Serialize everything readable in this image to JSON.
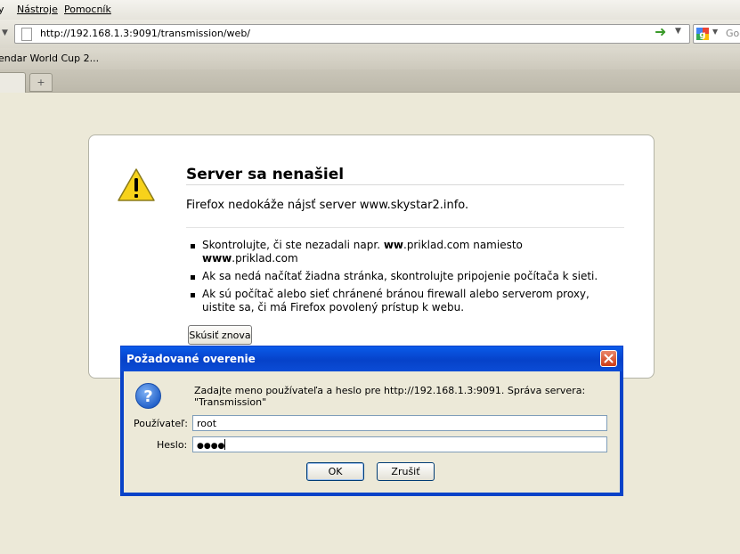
{
  "menu": {
    "items": [
      "y",
      "Nástroje",
      "Pomocník"
    ]
  },
  "navigation": {
    "url": "http://192.168.1.3:9091/transmission/web/",
    "search_placeholder": "Goo"
  },
  "bookmarks": {
    "items": [
      "endar World Cup 2..."
    ]
  },
  "tabs": {
    "new_tab_symbol": "+"
  },
  "error_page": {
    "title": "Server sa nenašiel",
    "short_desc": "Firefox nedokáže nájsť server www.skystar2.info.",
    "suggestion_1_pre": "Skontrolujte, či ste nezadali napr. ",
    "suggestion_1_b1": "ww",
    "suggestion_1_mid": ".priklad.com namiesto ",
    "suggestion_1_b2": "www",
    "suggestion_1_post": ".priklad.com",
    "suggestion_2": "Ak sa nedá načítať žiadna stránka, skontrolujte pripojenie počítača k sieti.",
    "suggestion_3": "Ak sú počítač alebo sieť chránené bránou firewall alebo serverom proxy, uistite sa, či má Firefox povolený prístup k webu.",
    "retry_label": "Skúsiť znova"
  },
  "auth_dialog": {
    "title": "Požadované overenie",
    "message": "Zadajte meno používateľa a heslo pre http://192.168.1.3:9091. Správa servera: \"Transmission\"",
    "username_label": "Používateľ:",
    "username_value": "root",
    "password_label": "Heslo:",
    "password_mask": "●●●●",
    "ok_label": "OK",
    "cancel_label": "Zrušiť"
  },
  "colors": {
    "dialog_titlebar": "#0642c9",
    "warning_icon": "#f7d21b",
    "question_icon": "#2a6fd6",
    "go_arrow": "#3a9a2a"
  }
}
